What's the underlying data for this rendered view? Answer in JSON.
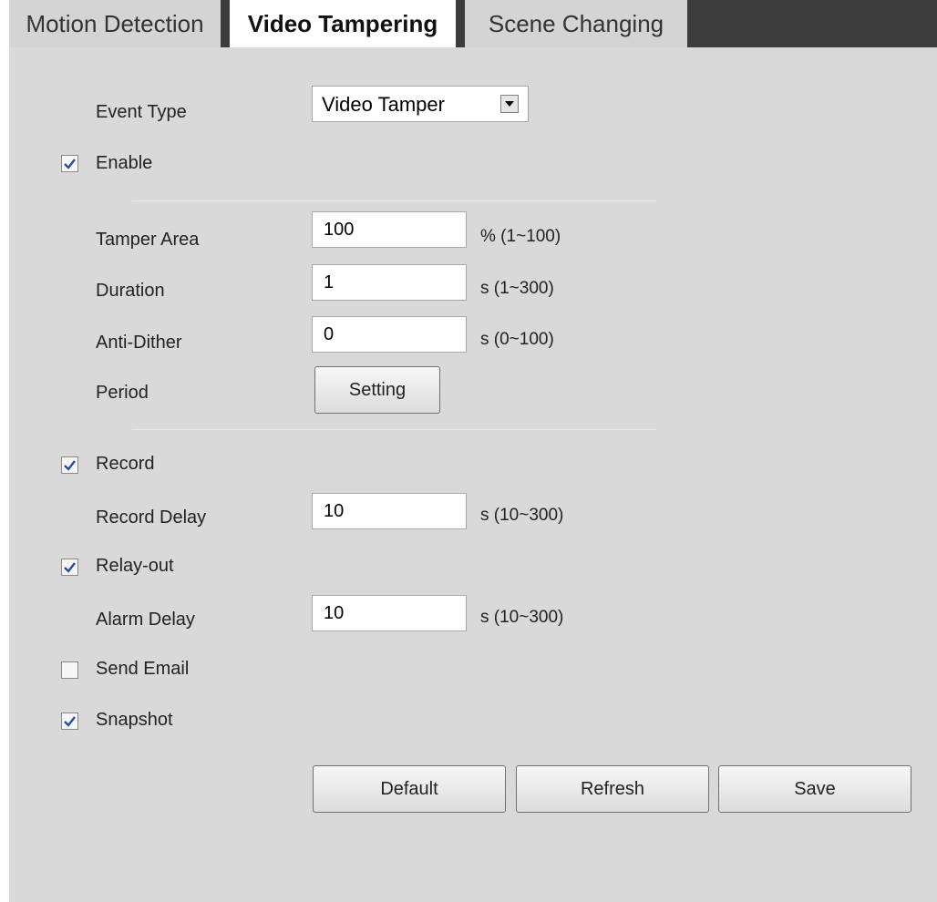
{
  "tabs": [
    {
      "label": "Motion Detection",
      "active": false
    },
    {
      "label": "Video Tampering",
      "active": true
    },
    {
      "label": "Scene Changing",
      "active": false
    }
  ],
  "form": {
    "event_type": {
      "label": "Event Type",
      "value": "Video Tamper"
    },
    "enable": {
      "label": "Enable",
      "checked": true
    },
    "tamper_area": {
      "label": "Tamper Area",
      "value": "100",
      "range": "% (1~100)"
    },
    "duration": {
      "label": "Duration",
      "value": "1",
      "range": "s (1~300)"
    },
    "anti_dither": {
      "label": "Anti-Dither",
      "value": "0",
      "range": "s (0~100)"
    },
    "period": {
      "label": "Period",
      "button": "Setting"
    },
    "record": {
      "label": "Record",
      "checked": true
    },
    "record_delay": {
      "label": "Record Delay",
      "value": "10",
      "range": "s (10~300)"
    },
    "relay_out": {
      "label": "Relay-out",
      "checked": true
    },
    "alarm_delay": {
      "label": "Alarm Delay",
      "value": "10",
      "range": "s (10~300)"
    },
    "send_email": {
      "label": "Send Email",
      "checked": false
    },
    "snapshot": {
      "label": "Snapshot",
      "checked": true
    }
  },
  "buttons": {
    "default": "Default",
    "refresh": "Refresh",
    "save": "Save"
  },
  "colors": {
    "active_tab": "#ffffff",
    "inactive_tab": "#d4d4d4",
    "tabbar": "#3c3c3c",
    "panel": "#d9d9d9",
    "check": "#2a4c9c"
  }
}
